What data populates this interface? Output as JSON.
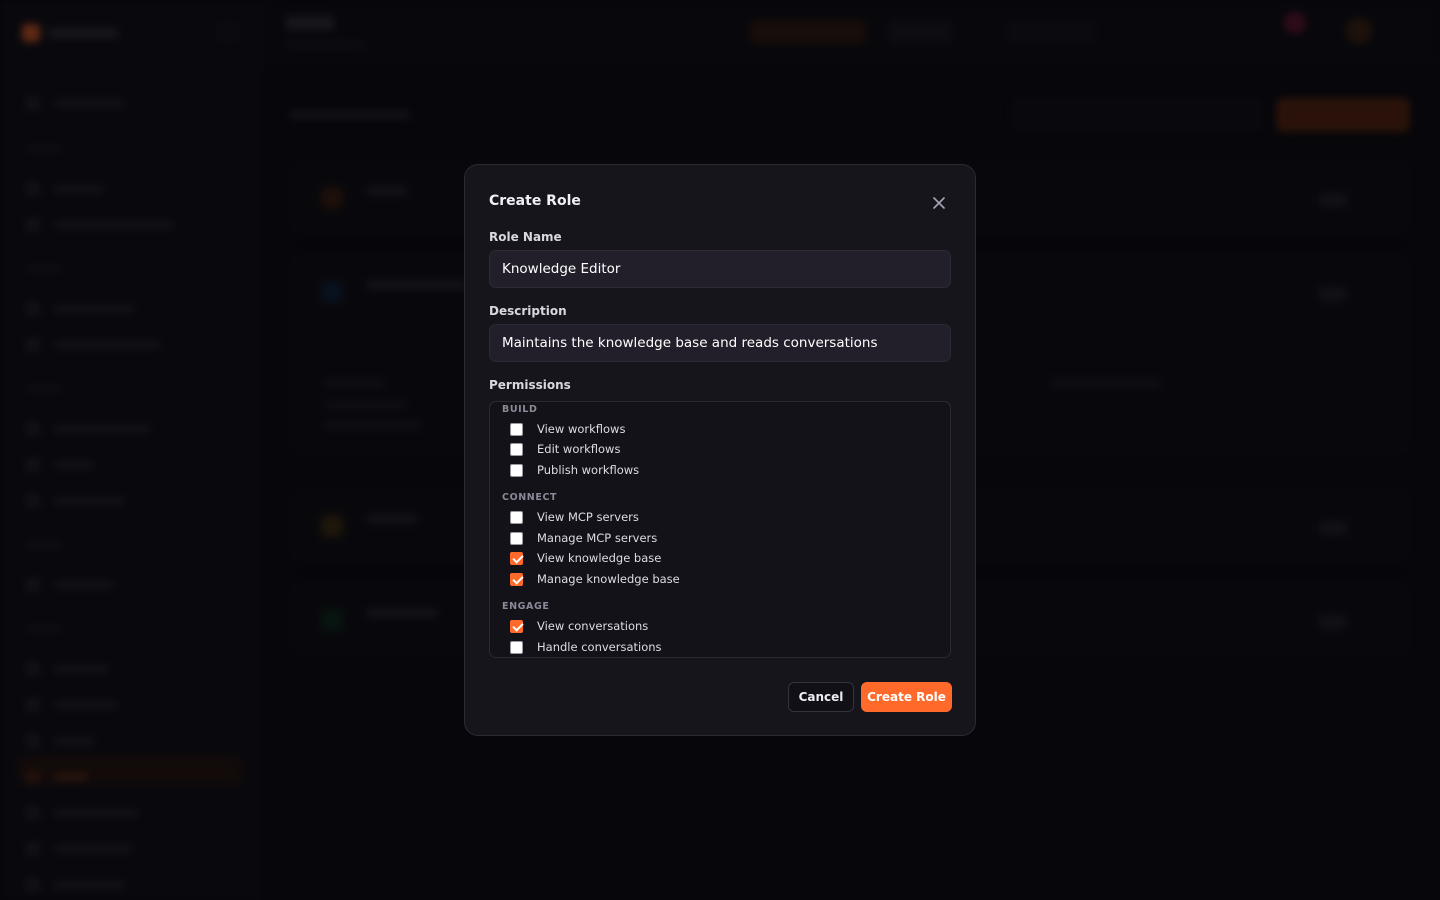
{
  "modal": {
    "title": "Create Role",
    "close_icon": "close-icon",
    "role_name": {
      "label": "Role Name",
      "value": "Knowledge Editor"
    },
    "description": {
      "label": "Description",
      "value": "Maintains the knowledge base and reads conversations"
    },
    "permissions": {
      "label": "Permissions",
      "groups": [
        {
          "label": "BUILD",
          "items": [
            {
              "label": "View workflows",
              "checked": false
            },
            {
              "label": "Edit workflows",
              "checked": false
            },
            {
              "label": "Publish workflows",
              "checked": false
            }
          ]
        },
        {
          "label": "CONNECT",
          "items": [
            {
              "label": "View MCP servers",
              "checked": false
            },
            {
              "label": "Manage MCP servers",
              "checked": false
            },
            {
              "label": "View knowledge base",
              "checked": true
            },
            {
              "label": "Manage knowledge base",
              "checked": true
            }
          ]
        },
        {
          "label": "ENGAGE",
          "items": [
            {
              "label": "View conversations",
              "checked": true
            },
            {
              "label": "Handle conversations",
              "checked": false
            }
          ]
        }
      ]
    },
    "cancel_label": "Cancel",
    "submit_label": "Create Role"
  },
  "colors": {
    "accent": "#ff6a2b",
    "modal_bg": "#16151c",
    "input_bg": "#221f2a"
  }
}
